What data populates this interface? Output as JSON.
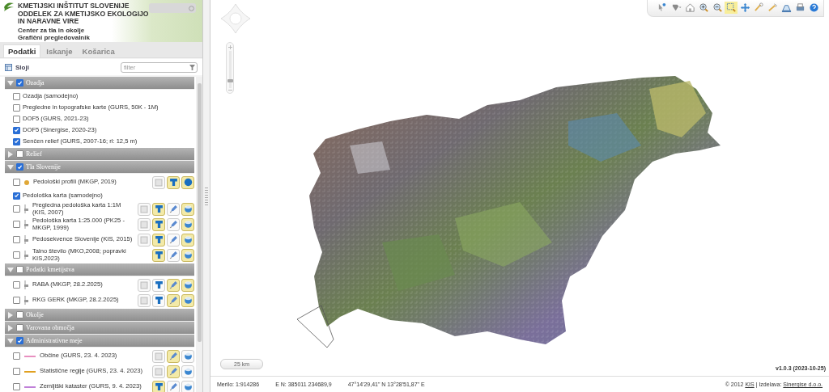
{
  "header": {
    "title_lines": [
      "KMETIJSKI INŠTITUT SLOVENIJE",
      "ODDELEK ZA KMETIJSKO EKOLOGIJO",
      "IN NARAVNE VIRE"
    ],
    "subtitle_lines": [
      "Center za tla in okolje",
      "Grafični pregledovalnik"
    ]
  },
  "tabs": [
    {
      "label": "Podatki",
      "selected": true
    },
    {
      "label": "Iskanje",
      "selected": false
    },
    {
      "label": "Košarica",
      "selected": false
    }
  ],
  "layers_panel": {
    "title": "Sloji",
    "filter_placeholder": "filter"
  },
  "groups": [
    {
      "label": "Ozadja",
      "checked": true,
      "expanded": true,
      "items": [
        {
          "label": "Ozadja (samodejno)",
          "checked": false
        },
        {
          "label": "Pregledne in topografske karte (GURS, 50K - 1M)",
          "checked": false
        },
        {
          "label": "DOF5 (GURS, 2021-23)",
          "checked": false
        },
        {
          "label": "DOF5 (Sinergise, 2020-23)",
          "checked": true
        },
        {
          "label": "Senčen relief (GURS, 2007-16; rl: 12,5 m)",
          "checked": true
        }
      ]
    },
    {
      "label": "Relief",
      "checked": false,
      "expanded": false
    },
    {
      "label": "Tla Slovenije",
      "checked": true,
      "expanded": true,
      "items": [
        {
          "label": "Pedološki profili (MKGP, 2019)",
          "checked": false,
          "symbol": {
            "kind": "dot",
            "color": "#e0a838"
          },
          "buttons": [
            {
              "kind": "legend",
              "on": false
            },
            {
              "kind": "label",
              "on": true
            },
            {
              "kind": "point",
              "on": true
            }
          ]
        },
        {
          "label": "Pedološka karta (samodejno)",
          "checked": true
        },
        {
          "label": "Pregledna pedološka karta 1:1M (KIS, 2007)",
          "checked": false,
          "symbol": {
            "kind": "slider",
            "color": "#999999"
          },
          "buttons": [
            {
              "kind": "legend",
              "on": false
            },
            {
              "kind": "label",
              "on": true
            },
            {
              "kind": "style",
              "on": false
            },
            {
              "kind": "info",
              "on": true
            }
          ]
        },
        {
          "label": "Pedološka karta 1:25.000 (PK25 - MKGP, 1999)",
          "checked": false,
          "symbol": {
            "kind": "slider",
            "color": "#999999"
          },
          "buttons": [
            {
              "kind": "legend",
              "on": false
            },
            {
              "kind": "label",
              "on": true
            },
            {
              "kind": "style",
              "on": false
            },
            {
              "kind": "info",
              "on": true
            }
          ]
        },
        {
          "label": "Pedosekvence Slovenije (KIS, 2015)",
          "checked": false,
          "symbol": {
            "kind": "slider",
            "color": "#999999"
          },
          "buttons": [
            {
              "kind": "legend",
              "on": false
            },
            {
              "kind": "label",
              "on": true
            },
            {
              "kind": "style",
              "on": false
            },
            {
              "kind": "info",
              "on": true
            }
          ]
        },
        {
          "label": "Talno število (MKO,2008; popravki KIS,2023)",
          "checked": false,
          "symbol": {
            "kind": "slider",
            "color": "#999999"
          },
          "buttons": [
            {
              "kind": "label",
              "on": true
            },
            {
              "kind": "style",
              "on": false
            },
            {
              "kind": "info",
              "on": true
            }
          ]
        }
      ]
    },
    {
      "label": "Podatki kmetijstva",
      "checked": false,
      "expanded": true,
      "items": [
        {
          "label": "RABA (MKGP, 28.2.2025)",
          "checked": false,
          "symbol": {
            "kind": "slider",
            "color": "#999999"
          },
          "buttons": [
            {
              "kind": "legend",
              "on": false
            },
            {
              "kind": "label",
              "on": false
            },
            {
              "kind": "style",
              "on": true
            },
            {
              "kind": "info",
              "on": true
            }
          ]
        },
        {
          "label": "RKG GERK (MKGP, 28.2.2025)",
          "checked": false,
          "symbol": {
            "kind": "slider",
            "color": "#999999"
          },
          "buttons": [
            {
              "kind": "legend",
              "on": false
            },
            {
              "kind": "label",
              "on": false
            },
            {
              "kind": "style",
              "on": true
            },
            {
              "kind": "info",
              "on": true
            }
          ]
        }
      ]
    },
    {
      "label": "Okolje",
      "checked": false,
      "expanded": false
    },
    {
      "label": "Varovana območja",
      "checked": false,
      "expanded": false
    },
    {
      "label": "Administrativne meje",
      "checked": true,
      "expanded": true,
      "items": [
        {
          "label": "Občine (GURS, 23. 4. 2023)",
          "checked": false,
          "symbol": {
            "kind": "line",
            "color": "#e890c0"
          },
          "buttons": [
            {
              "kind": "legend",
              "on": false
            },
            {
              "kind": "style",
              "on": true
            },
            {
              "kind": "info",
              "on": false
            }
          ]
        },
        {
          "label": "Statistične regije (GURS, 23. 4. 2023)",
          "checked": false,
          "symbol": {
            "kind": "line",
            "color": "#e0a020"
          },
          "buttons": [
            {
              "kind": "legend",
              "on": false
            },
            {
              "kind": "style",
              "on": true
            },
            {
              "kind": "info",
              "on": false
            }
          ]
        },
        {
          "label": "Zemljiški kataster (GURS, 9. 4. 2023)",
          "checked": false,
          "symbol": {
            "kind": "line",
            "color": "#c080d8"
          },
          "buttons": [
            {
              "kind": "label",
              "on": true
            },
            {
              "kind": "style",
              "on": false
            },
            {
              "kind": "info",
              "on": false
            }
          ]
        }
      ]
    }
  ],
  "toolbar": [
    {
      "kind": "identify",
      "selected": false
    },
    {
      "kind": "draw",
      "selected": false
    },
    {
      "kind": "home",
      "selected": false
    },
    {
      "kind": "zoom-in",
      "selected": false
    },
    {
      "kind": "zoom-out",
      "selected": false
    },
    {
      "kind": "zoom-box",
      "selected": true
    },
    {
      "kind": "pan",
      "selected": false
    },
    {
      "kind": "measure",
      "selected": false
    },
    {
      "kind": "area",
      "selected": false
    },
    {
      "kind": "export",
      "selected": false
    },
    {
      "kind": "print",
      "selected": false
    },
    {
      "kind": "help",
      "selected": false
    }
  ],
  "zoom": {
    "level": 0.15
  },
  "scale": "25 km",
  "version": "v1.0.3 (2023-10-25)",
  "status": {
    "scale": "Merilo: 1:914286",
    "en": "E N: 385011 234689,9",
    "latlon": "47°14'29,41\" N 13°28'51,87\" E",
    "credits_prefix": "© 2012",
    "credits_link": "KIS",
    "credits_middle": "| Izdelava:",
    "credits_vendor": "Sinergise d.o.o."
  }
}
